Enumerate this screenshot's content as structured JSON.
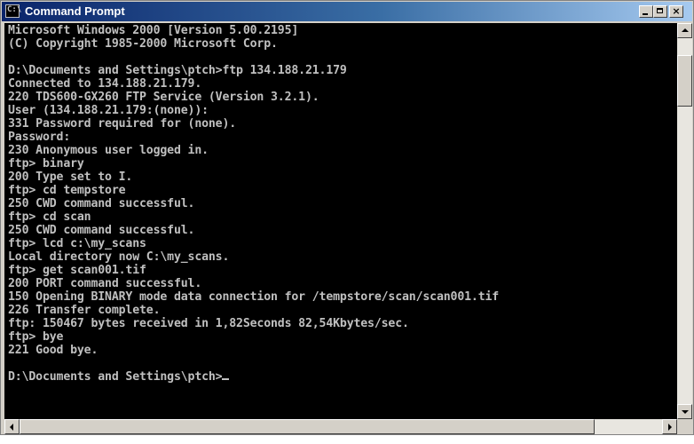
{
  "window": {
    "title": "Command Prompt",
    "icon": "cmd-icon",
    "icon_glyph": "C:\\",
    "controls": {
      "minimize": "minimize-icon",
      "maximize": "maximize-icon",
      "close": "close-icon",
      "close_glyph": "×"
    }
  },
  "console": {
    "text_color": "#c0c0c0",
    "background": "#000000",
    "lines": [
      "Microsoft Windows 2000 [Version 5.00.2195]",
      "(C) Copyright 1985-2000 Microsoft Corp.",
      "",
      "D:\\Documents and Settings\\ptch>ftp 134.188.21.179",
      "Connected to 134.188.21.179.",
      "220 TDS600-GX260 FTP Service (Version 3.2.1).",
      "User (134.188.21.179:(none)):",
      "331 Password required for (none).",
      "Password:",
      "230 Anonymous user logged in.",
      "ftp> binary",
      "200 Type set to I.",
      "ftp> cd tempstore",
      "250 CWD command successful.",
      "ftp> cd scan",
      "250 CWD command successful.",
      "ftp> lcd c:\\my_scans",
      "Local directory now C:\\my_scans.",
      "ftp> get scan001.tif",
      "200 PORT command successful.",
      "150 Opening BINARY mode data connection for /tempstore/scan/scan001.tif",
      "226 Transfer complete.",
      "ftp: 150467 bytes received in 1,82Seconds 82,54Kbytes/sec.",
      "ftp> bye",
      "221 Good bye.",
      "",
      "D:\\Documents and Settings\\ptch>"
    ]
  },
  "scrollbars": {
    "vertical": {
      "up": "arrow-up-icon",
      "down": "arrow-down-icon"
    },
    "horizontal": {
      "left": "arrow-left-icon",
      "right": "arrow-right-icon"
    }
  }
}
